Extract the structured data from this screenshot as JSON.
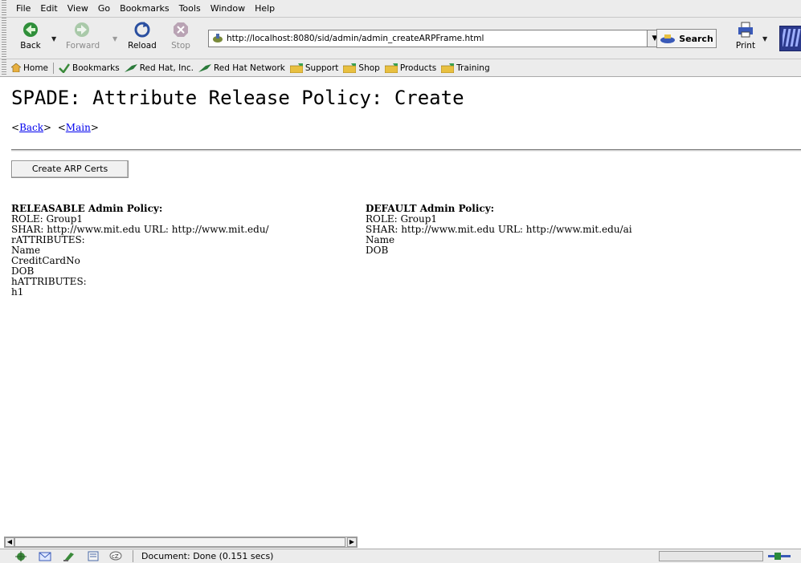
{
  "menubar": {
    "items": [
      "File",
      "Edit",
      "View",
      "Go",
      "Bookmarks",
      "Tools",
      "Window",
      "Help"
    ]
  },
  "toolbar": {
    "back_label": "Back",
    "forward_label": "Forward",
    "reload_label": "Reload",
    "stop_label": "Stop",
    "url_value": "http://localhost:8080/sid/admin/admin_createARPFrame.html",
    "search_label": "Search",
    "print_label": "Print"
  },
  "personal_bar": {
    "items": [
      "Home",
      "Bookmarks",
      "Red Hat, Inc.",
      "Red Hat Network",
      "Support",
      "Shop",
      "Products",
      "Training"
    ]
  },
  "page": {
    "title": "SPADE: Attribute Release Policy: Create",
    "back_link": "Back",
    "main_link": "Main",
    "create_button": "Create ARP Certs",
    "releasable": {
      "heading": "RELEASABLE Admin Policy:",
      "lines": [
        "ROLE: Group1",
        "SHAR: http://www.mit.edu URL: http://www.mit.edu/",
        "rATTRIBUTES:",
        "Name",
        "CreditCardNo",
        "DOB",
        "hATTRIBUTES:",
        "h1"
      ]
    },
    "default": {
      "heading": "DEFAULT Admin Policy:",
      "lines": [
        "ROLE: Group1",
        "SHAR: http://www.mit.edu URL: http://www.mit.edu/ai",
        "Name",
        "DOB"
      ]
    }
  },
  "statusbar": {
    "text": "Document: Done (0.151 secs)"
  }
}
